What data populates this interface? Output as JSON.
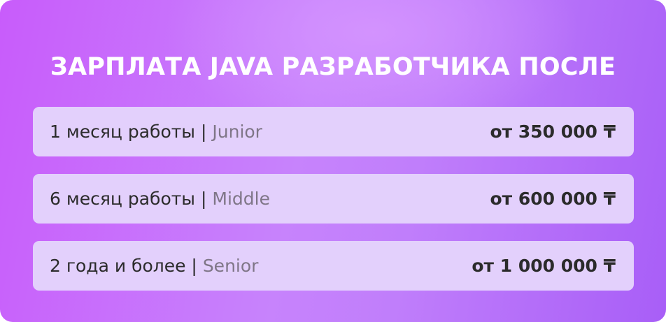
{
  "title": "ЗАРПЛАТА JAVA РАЗРАБОТЧИКА ПОСЛЕ",
  "rows": [
    {
      "period": "1 месяц работы | ",
      "level": "Junior",
      "salary": "от 350 000 ₸"
    },
    {
      "period": "6 месяц работы | ",
      "level": "Middle",
      "salary": "от 600 000 ₸"
    },
    {
      "period": "2 года и более | ",
      "level": "Senior",
      "salary": "от 1 000 000 ₸"
    }
  ],
  "colors": {
    "background_start": "#c85cfb",
    "background_end": "#a85ef7",
    "row_background": "#e3d0fc",
    "text_dark": "#2b2b2b",
    "text_muted": "#7f7687",
    "title_text": "#ffffff"
  }
}
